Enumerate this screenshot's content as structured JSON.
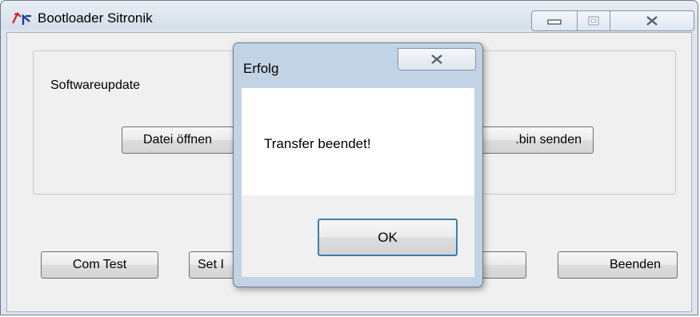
{
  "main_window": {
    "title": "Bootloader Sitronik",
    "icon": "bootloader-app-icon",
    "controls": {
      "minimize": "minimize-icon",
      "maximize": "maximize-icon",
      "close": "close-icon"
    },
    "group": {
      "label": "Softwareupdate",
      "open_file_button": "Datei öffnen",
      "send_bin_button": ".bin senden"
    },
    "bottom_buttons": {
      "com_test": "Com Test",
      "set_partial": "Set I",
      "exit": "Beenden"
    }
  },
  "dialog": {
    "title": "Erfolg",
    "message": "Transfer beendet!",
    "ok_button": "OK",
    "close_icon": "close-icon"
  }
}
